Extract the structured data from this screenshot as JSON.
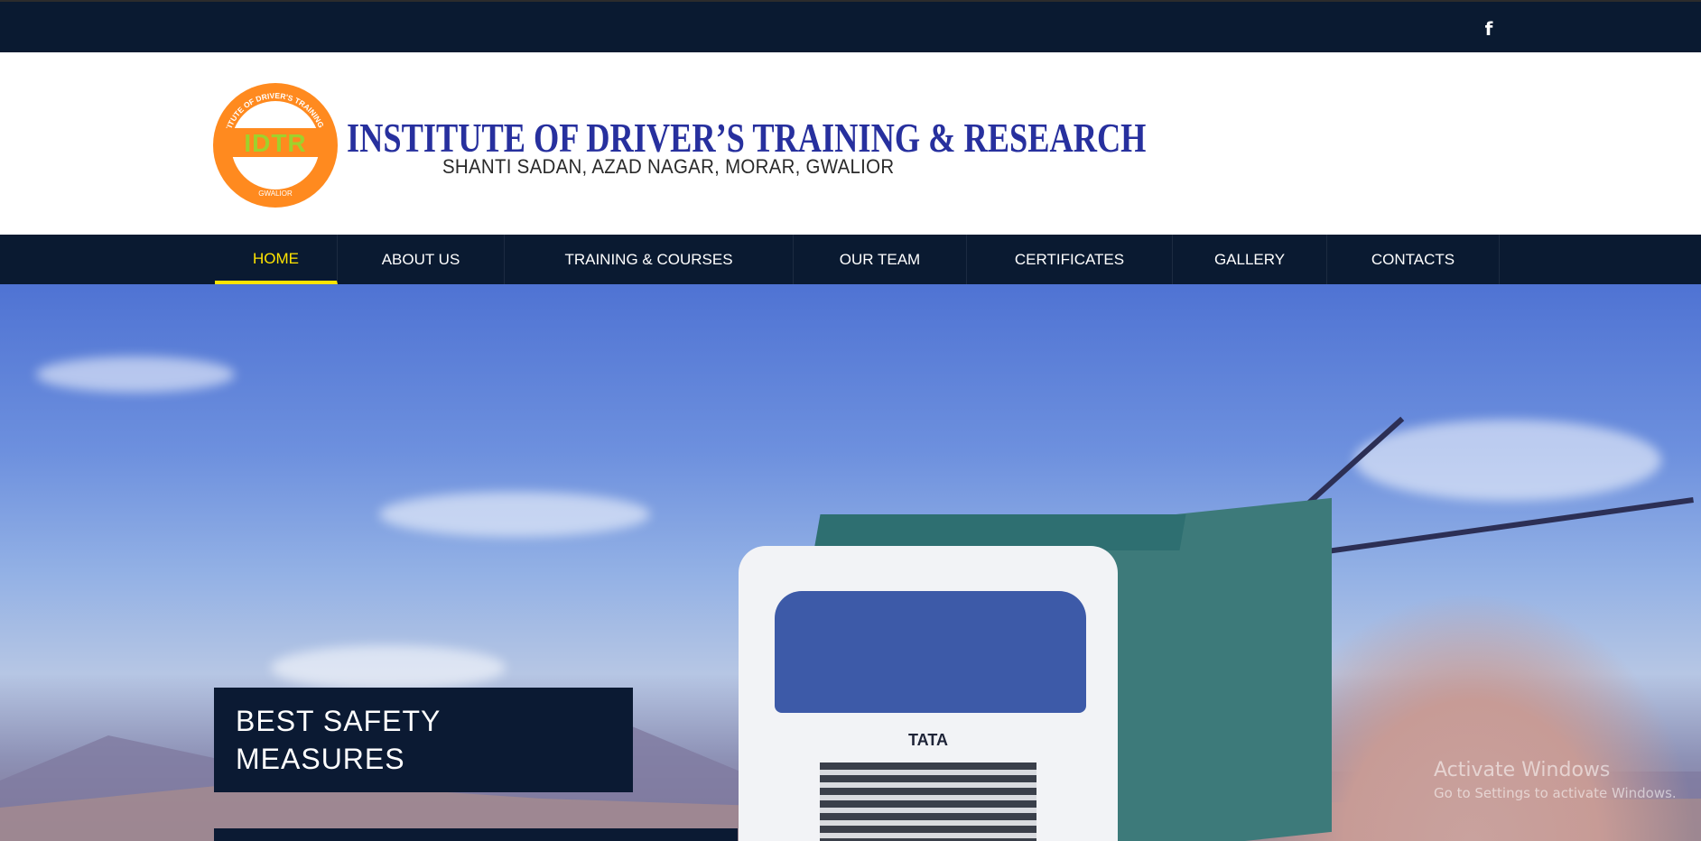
{
  "topbar": {
    "social": [
      {
        "label": "f",
        "icon": "facebook-icon"
      }
    ]
  },
  "header": {
    "logo_text": "IDTR",
    "logo_ring_text": "INSTITUTE OF DRIVER'S TRAINING & RESEARCH",
    "logo_bottom_text": "GWALIOR",
    "title": "INSTITUTE OF DRIVER’S TRAINING & RESEARCH",
    "subtitle": "SHANTI SADAN, AZAD NAGAR, MORAR, GWALIOR"
  },
  "nav": {
    "items": [
      {
        "label": "HOME",
        "active": true
      },
      {
        "label": "ABOUT US",
        "active": false
      },
      {
        "label": "TRAINING & COURSES",
        "active": false
      },
      {
        "label": "OUR TEAM",
        "active": false
      },
      {
        "label": "CERTIFICATES",
        "active": false
      },
      {
        "label": "GALLERY",
        "active": false
      },
      {
        "label": "CONTACTS",
        "active": false
      }
    ]
  },
  "hero": {
    "caption_line1": "BEST SAFETY",
    "caption_line2": "MEASURES",
    "truck_brand": "TATA"
  },
  "watermark": {
    "title": "Activate Windows",
    "subtitle": "Go to Settings to activate Windows."
  },
  "colors": {
    "nav_bg": "#0a1a31",
    "active": "#ffe400",
    "title_blue": "#27309e",
    "logo_orange": "#ff8a1f",
    "logo_green": "#9fd12c"
  }
}
